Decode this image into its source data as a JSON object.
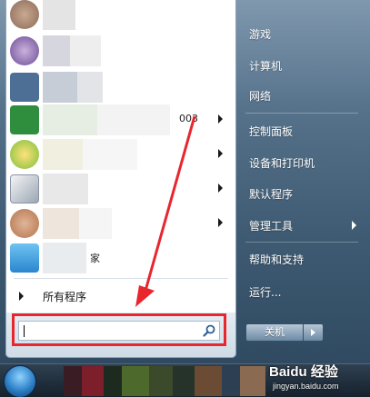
{
  "start_menu": {
    "programs": [
      {
        "text": "",
        "has_arrow": false
      },
      {
        "text": "",
        "has_arrow": false
      },
      {
        "text": "",
        "has_arrow": false
      },
      {
        "text": "003",
        "has_arrow": true
      },
      {
        "text": "",
        "has_arrow": true
      },
      {
        "text": "",
        "has_arrow": true
      },
      {
        "text": "",
        "has_arrow": true
      },
      {
        "text": "家",
        "has_arrow": false
      }
    ],
    "all_programs_label": "所有程序",
    "search": {
      "value": "",
      "placeholder": ""
    },
    "right_items": [
      {
        "label": "游戏",
        "has_arrow": false
      },
      {
        "label": "计算机",
        "has_arrow": false
      },
      {
        "label": "网络",
        "has_arrow": false
      },
      {
        "label": "控制面板",
        "has_arrow": false
      },
      {
        "label": "设备和打印机",
        "has_arrow": false
      },
      {
        "label": "默认程序",
        "has_arrow": false
      },
      {
        "label": "管理工具",
        "has_arrow": true
      },
      {
        "label": "帮助和支持",
        "has_arrow": false
      },
      {
        "label": "运行...",
        "has_arrow": false
      }
    ],
    "shutdown_label": "关机"
  },
  "colors": {
    "highlight_red": "#e8262e",
    "menu_blue": "#4f6b84"
  },
  "watermark": {
    "logo": "Baidu 经验",
    "url": "jingyan.baidu.com"
  }
}
